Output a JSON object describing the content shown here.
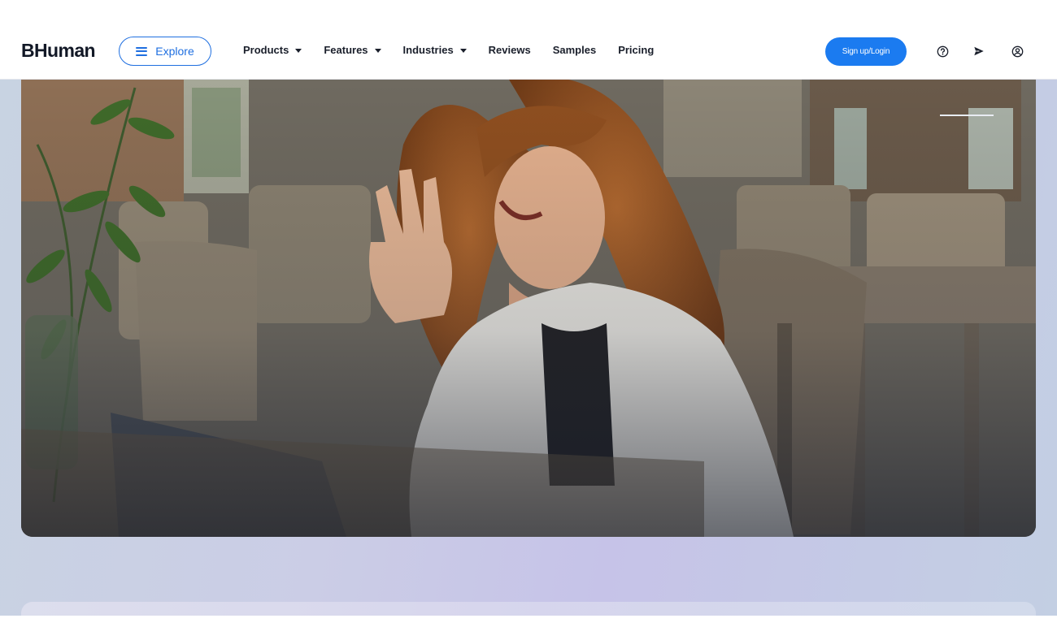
{
  "header": {
    "logo": "BHuman",
    "explore_label": "Explore",
    "nav": [
      {
        "label": "Products",
        "dropdown": true
      },
      {
        "label": "Features",
        "dropdown": true
      },
      {
        "label": "Industries",
        "dropdown": true
      },
      {
        "label": "Reviews",
        "dropdown": false
      },
      {
        "label": "Samples",
        "dropdown": false
      },
      {
        "label": "Pricing",
        "dropdown": false
      }
    ],
    "signup_label": "Sign up/Login",
    "icons": [
      "help-icon",
      "send-icon",
      "account-icon"
    ]
  },
  "colors": {
    "accent": "#1b7bf0",
    "explore_border": "#1f6fe0",
    "text_dark": "#1a1f2b"
  },
  "hero": {
    "image": "woman waving at laptop in cafe"
  }
}
